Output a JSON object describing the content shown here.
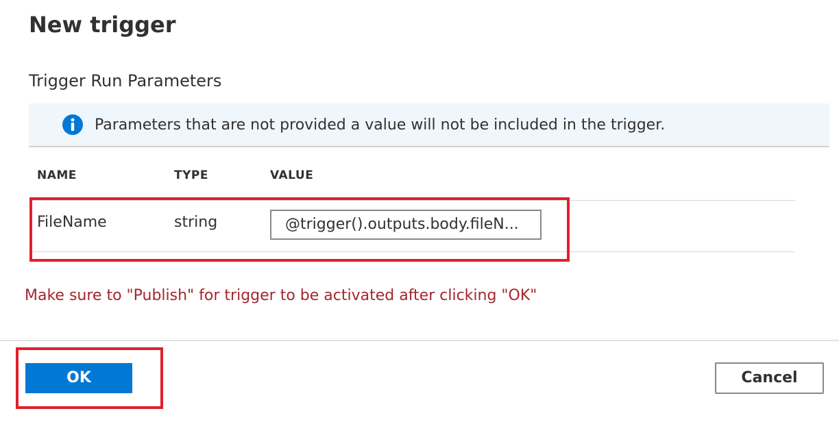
{
  "dialog": {
    "title": "New trigger",
    "section_title": "Trigger Run Parameters"
  },
  "info_bar": {
    "icon": "info-icon",
    "message": "Parameters that are not provided a value will not be included in the trigger.",
    "background_color": "#eff6fc",
    "icon_color": "#0078d4"
  },
  "parameters_table": {
    "columns": [
      "NAME",
      "TYPE",
      "VALUE"
    ],
    "rows": [
      {
        "name": "FileName",
        "type": "string",
        "value": "@trigger().outputs.body.fileN..."
      }
    ]
  },
  "warning": {
    "text": "Make sure to \"Publish\" for trigger to be activated after clicking \"OK\"",
    "color": "#a4262c"
  },
  "footer": {
    "ok_label": "OK",
    "cancel_label": "Cancel",
    "primary_color": "#0078d4"
  },
  "annotations": {
    "highlight_color": "#e0202e"
  }
}
